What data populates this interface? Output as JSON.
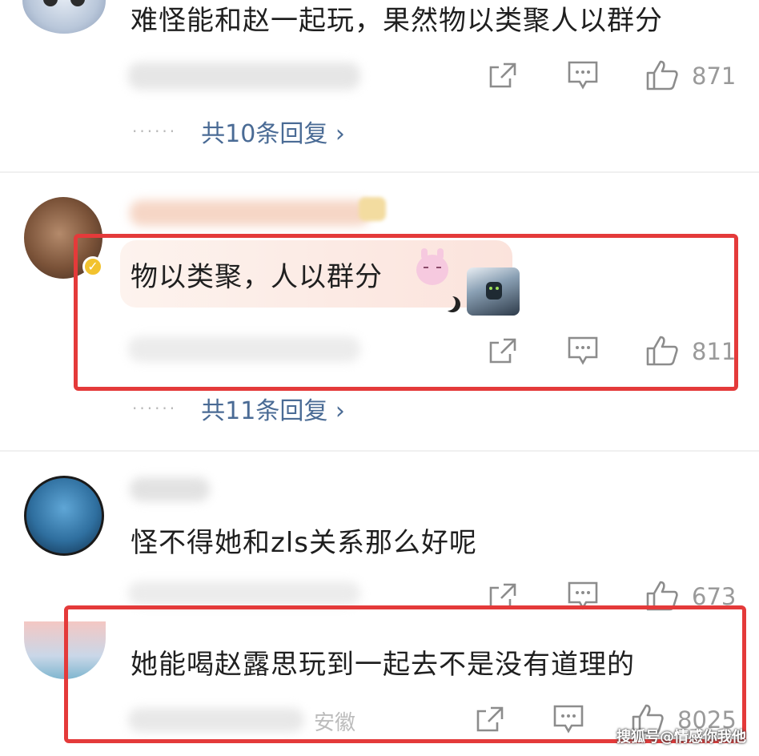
{
  "comments": [
    {
      "text": "难怪能和赵一起玩，果然物以类聚人以群分",
      "likes": "871",
      "replies_label": "共10条回复",
      "dots": "······",
      "chevron": "›"
    },
    {
      "text": "物以类聚，人以群分",
      "likes": "811",
      "replies_label": "共11条回复",
      "dots": "······",
      "chevron": "›",
      "verified_color": "#f2c22e",
      "emoji": "pink-bunny-emoji",
      "sticker": "moon-knight-sticker"
    },
    {
      "text": "怪不得她和zls关系那么好呢",
      "likes": "673"
    },
    {
      "text": "她能喝赵露思玩到一起去不是没有道理的",
      "likes": "8025",
      "location": "安徽"
    }
  ],
  "icons": {
    "share": "share-icon",
    "comment": "comment-icon",
    "like": "thumbs-up-icon"
  },
  "colors": {
    "highlight_border": "#e43a3a",
    "reply_link": "#4a6b95",
    "count_gray": "#9a9a9a"
  },
  "watermark": "搜狐号@情感你我他"
}
